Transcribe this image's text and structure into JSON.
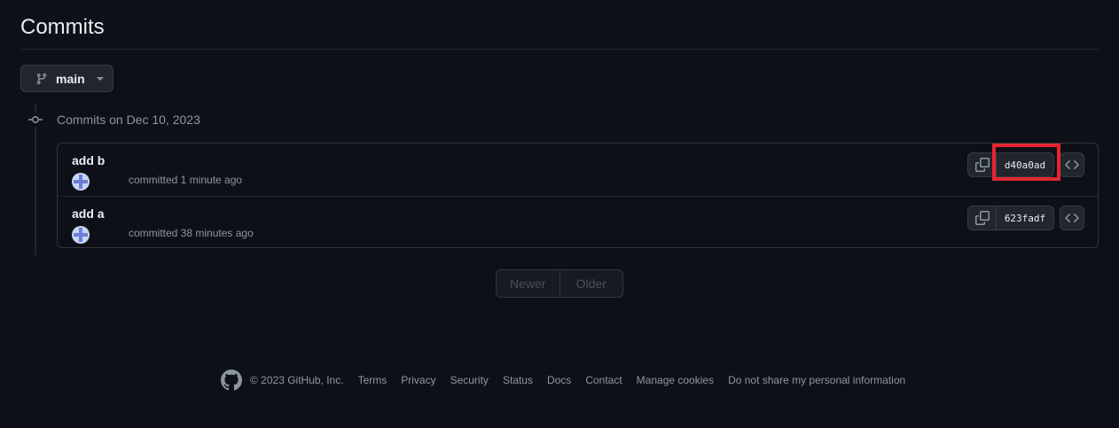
{
  "page": {
    "title": "Commits"
  },
  "branch": {
    "name": "main"
  },
  "group": {
    "header": "Commits on Dec 10, 2023"
  },
  "commits": [
    {
      "title": "add b",
      "meta": "committed 1 minute ago",
      "sha": "d40a0ad"
    },
    {
      "title": "add a",
      "meta": "committed 38 minutes ago",
      "sha": "623fadf"
    }
  ],
  "pagination": {
    "newer": "Newer",
    "older": "Older"
  },
  "footer": {
    "copyright": "© 2023 GitHub, Inc.",
    "links": [
      "Terms",
      "Privacy",
      "Security",
      "Status",
      "Docs",
      "Contact",
      "Manage cookies",
      "Do not share my personal information"
    ]
  },
  "colors": {
    "background": "#0d1117",
    "highlight": "#e4252f",
    "muted": "#8d96a0"
  }
}
